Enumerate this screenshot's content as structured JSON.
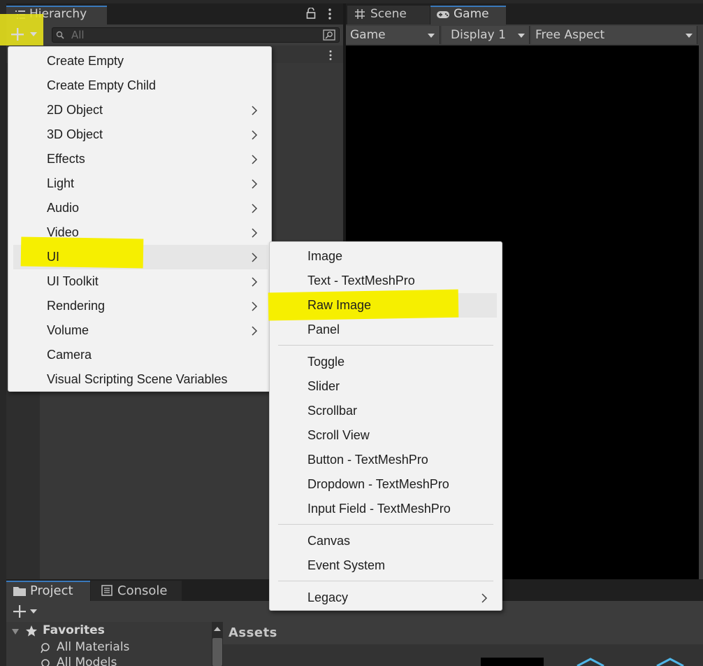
{
  "hierarchy": {
    "tab_label": "Hierarchy",
    "search_placeholder": "All"
  },
  "game_panel": {
    "tabs": [
      {
        "label": "Scene"
      },
      {
        "label": "Game"
      }
    ],
    "toolbar": {
      "view_mode": "Game",
      "display": "Display 1",
      "aspect": "Free Aspect"
    }
  },
  "create_menu": {
    "items": [
      {
        "label": "Create Empty",
        "has_submenu": false
      },
      {
        "label": "Create Empty Child",
        "has_submenu": false
      },
      {
        "label": "2D Object",
        "has_submenu": true
      },
      {
        "label": "3D Object",
        "has_submenu": true
      },
      {
        "label": "Effects",
        "has_submenu": true
      },
      {
        "label": "Light",
        "has_submenu": true
      },
      {
        "label": "Audio",
        "has_submenu": true
      },
      {
        "label": "Video",
        "has_submenu": true
      },
      {
        "label": "UI",
        "has_submenu": true
      },
      {
        "label": "UI Toolkit",
        "has_submenu": true
      },
      {
        "label": "Rendering",
        "has_submenu": true
      },
      {
        "label": "Volume",
        "has_submenu": true
      },
      {
        "label": "Camera",
        "has_submenu": false
      },
      {
        "label": "Visual Scripting Scene Variables",
        "has_submenu": false
      }
    ]
  },
  "ui_submenu": {
    "items": [
      {
        "label": "Image"
      },
      {
        "label": "Text - TextMeshPro"
      },
      {
        "label": "Raw Image"
      },
      {
        "label": "Panel"
      },
      {
        "label": "Toggle"
      },
      {
        "label": "Slider"
      },
      {
        "label": "Scrollbar"
      },
      {
        "label": "Scroll View"
      },
      {
        "label": "Button - TextMeshPro"
      },
      {
        "label": "Dropdown - TextMeshPro"
      },
      {
        "label": "Input Field - TextMeshPro"
      },
      {
        "label": "Canvas"
      },
      {
        "label": "Event System"
      },
      {
        "label": "Legacy",
        "has_submenu": true
      }
    ]
  },
  "project_panel": {
    "tabs": [
      {
        "label": "Project"
      },
      {
        "label": "Console"
      }
    ],
    "favorites": {
      "label": "Favorites",
      "items": [
        "All Materials",
        "All Models"
      ]
    },
    "assets_header": "Assets"
  },
  "colors": {
    "highlight": "#f6ef00",
    "tab_accent": "#3a79bb",
    "menu_bg": "#f2f2f2",
    "panel_bg": "#383838"
  }
}
